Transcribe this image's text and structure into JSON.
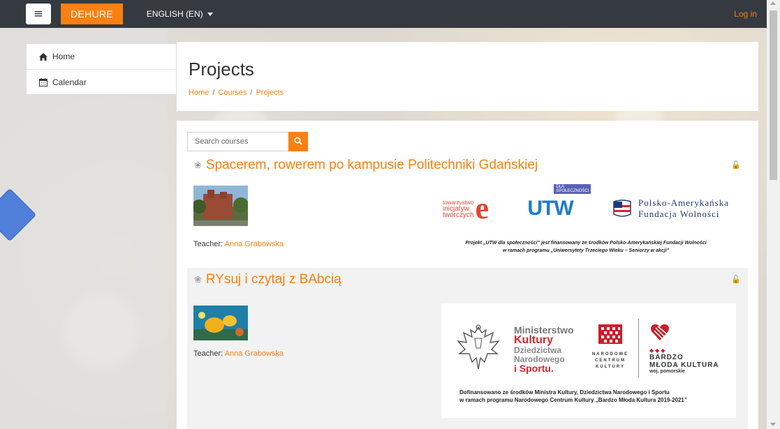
{
  "navbar": {
    "menu_icon": "hamburger-icon",
    "brand": "DEHURE",
    "language": "ENGLISH (EN)",
    "login": "Log in"
  },
  "sidebar": {
    "items": [
      {
        "label": "Home",
        "icon": "home-icon"
      },
      {
        "label": "Calendar",
        "icon": "calendar-icon"
      }
    ]
  },
  "header": {
    "title": "Projects",
    "breadcrumb": [
      "Home",
      "Courses",
      "Projects"
    ],
    "breadcrumb_separator": "/"
  },
  "search": {
    "placeholder": "Search courses",
    "button_icon": "search-icon"
  },
  "courses": [
    {
      "title": "Spacerem, rowerem po kampusie Politechniki Gdańskiej",
      "teacher_label": "Teacher:",
      "teacher_name": "Anna Grabowska",
      "sponsor": {
        "logo1_text": [
          "towarzystwo",
          "inicjatyw",
          "twórczych"
        ],
        "logo1_letter": "e",
        "logo2_text": "UTW",
        "logo2_badge": "DLA SPOŁECZNOŚCI",
        "logo3_lines": [
          "Polsko-Amerykańska",
          "Fundacja Wolności"
        ],
        "caption_lines": [
          "Projekt „UTW dla społeczności” jest finansowany ze środków Polsko-Amerykańskiej Fundacji Wolności",
          "w ramach programu „Uniwersytety Trzeciego Wieku – Seniorzy w akcji”"
        ]
      }
    },
    {
      "title": "RYsuj i czytaj z BAbcią",
      "teacher_label": "Teacher:",
      "teacher_name": "Anna Grabowska",
      "sponsor": {
        "ministry_lines": [
          "Ministerstwo",
          "Kultury",
          "Dziedzictwa",
          "Narodowego",
          "i Sportu."
        ],
        "nck_lines": [
          "NARODOWE",
          "CENTRUM",
          "KULTURY"
        ],
        "bmk_lines": [
          "BARDZO",
          "MŁODA KULTURA",
          "woj. pomorskie"
        ],
        "caption_lines": [
          "Dofinansowano ze środków Ministra Kultury, Dziedzictwa Narodowego i Sportu",
          "w ramach programu Narodowego Centrum Kultury „Bardzo Młoda Kultura 2019-2021”"
        ]
      }
    }
  ],
  "colors": {
    "accent": "#f98012",
    "navbar": "#343a40",
    "arrow": "#4f7fd8"
  }
}
